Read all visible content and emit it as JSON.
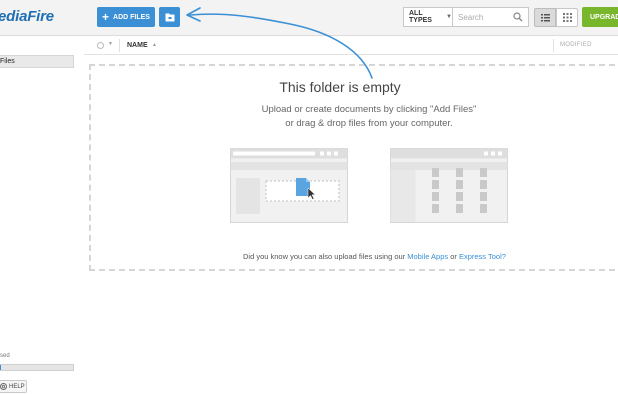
{
  "header": {
    "logo_text": "ediaFire",
    "add_files_label": "ADD FILES",
    "type_filter_label": "ALL TYPES",
    "search_placeholder": "Search",
    "upgrade_label": "UPGRADE"
  },
  "sidebar": {
    "my_files_label": "Files",
    "storage_label": "sed",
    "storage_used_fraction": 0.02,
    "help_label": "HELP"
  },
  "columns": {
    "name_label": "NAME",
    "modified_label": "MODIFIED"
  },
  "empty_state": {
    "title": "This folder is empty",
    "line1": "Upload or create documents by clicking \"Add Files\"",
    "line2": "or drag & drop files from your computer.",
    "tip_prefix": "Did you know you can also upload files using our ",
    "tip_link1": "Mobile Apps",
    "tip_or": " or ",
    "tip_link2": "Express Tool?"
  },
  "colors": {
    "accent_blue": "#3b8fd4",
    "upgrade_green": "#78b62c"
  }
}
